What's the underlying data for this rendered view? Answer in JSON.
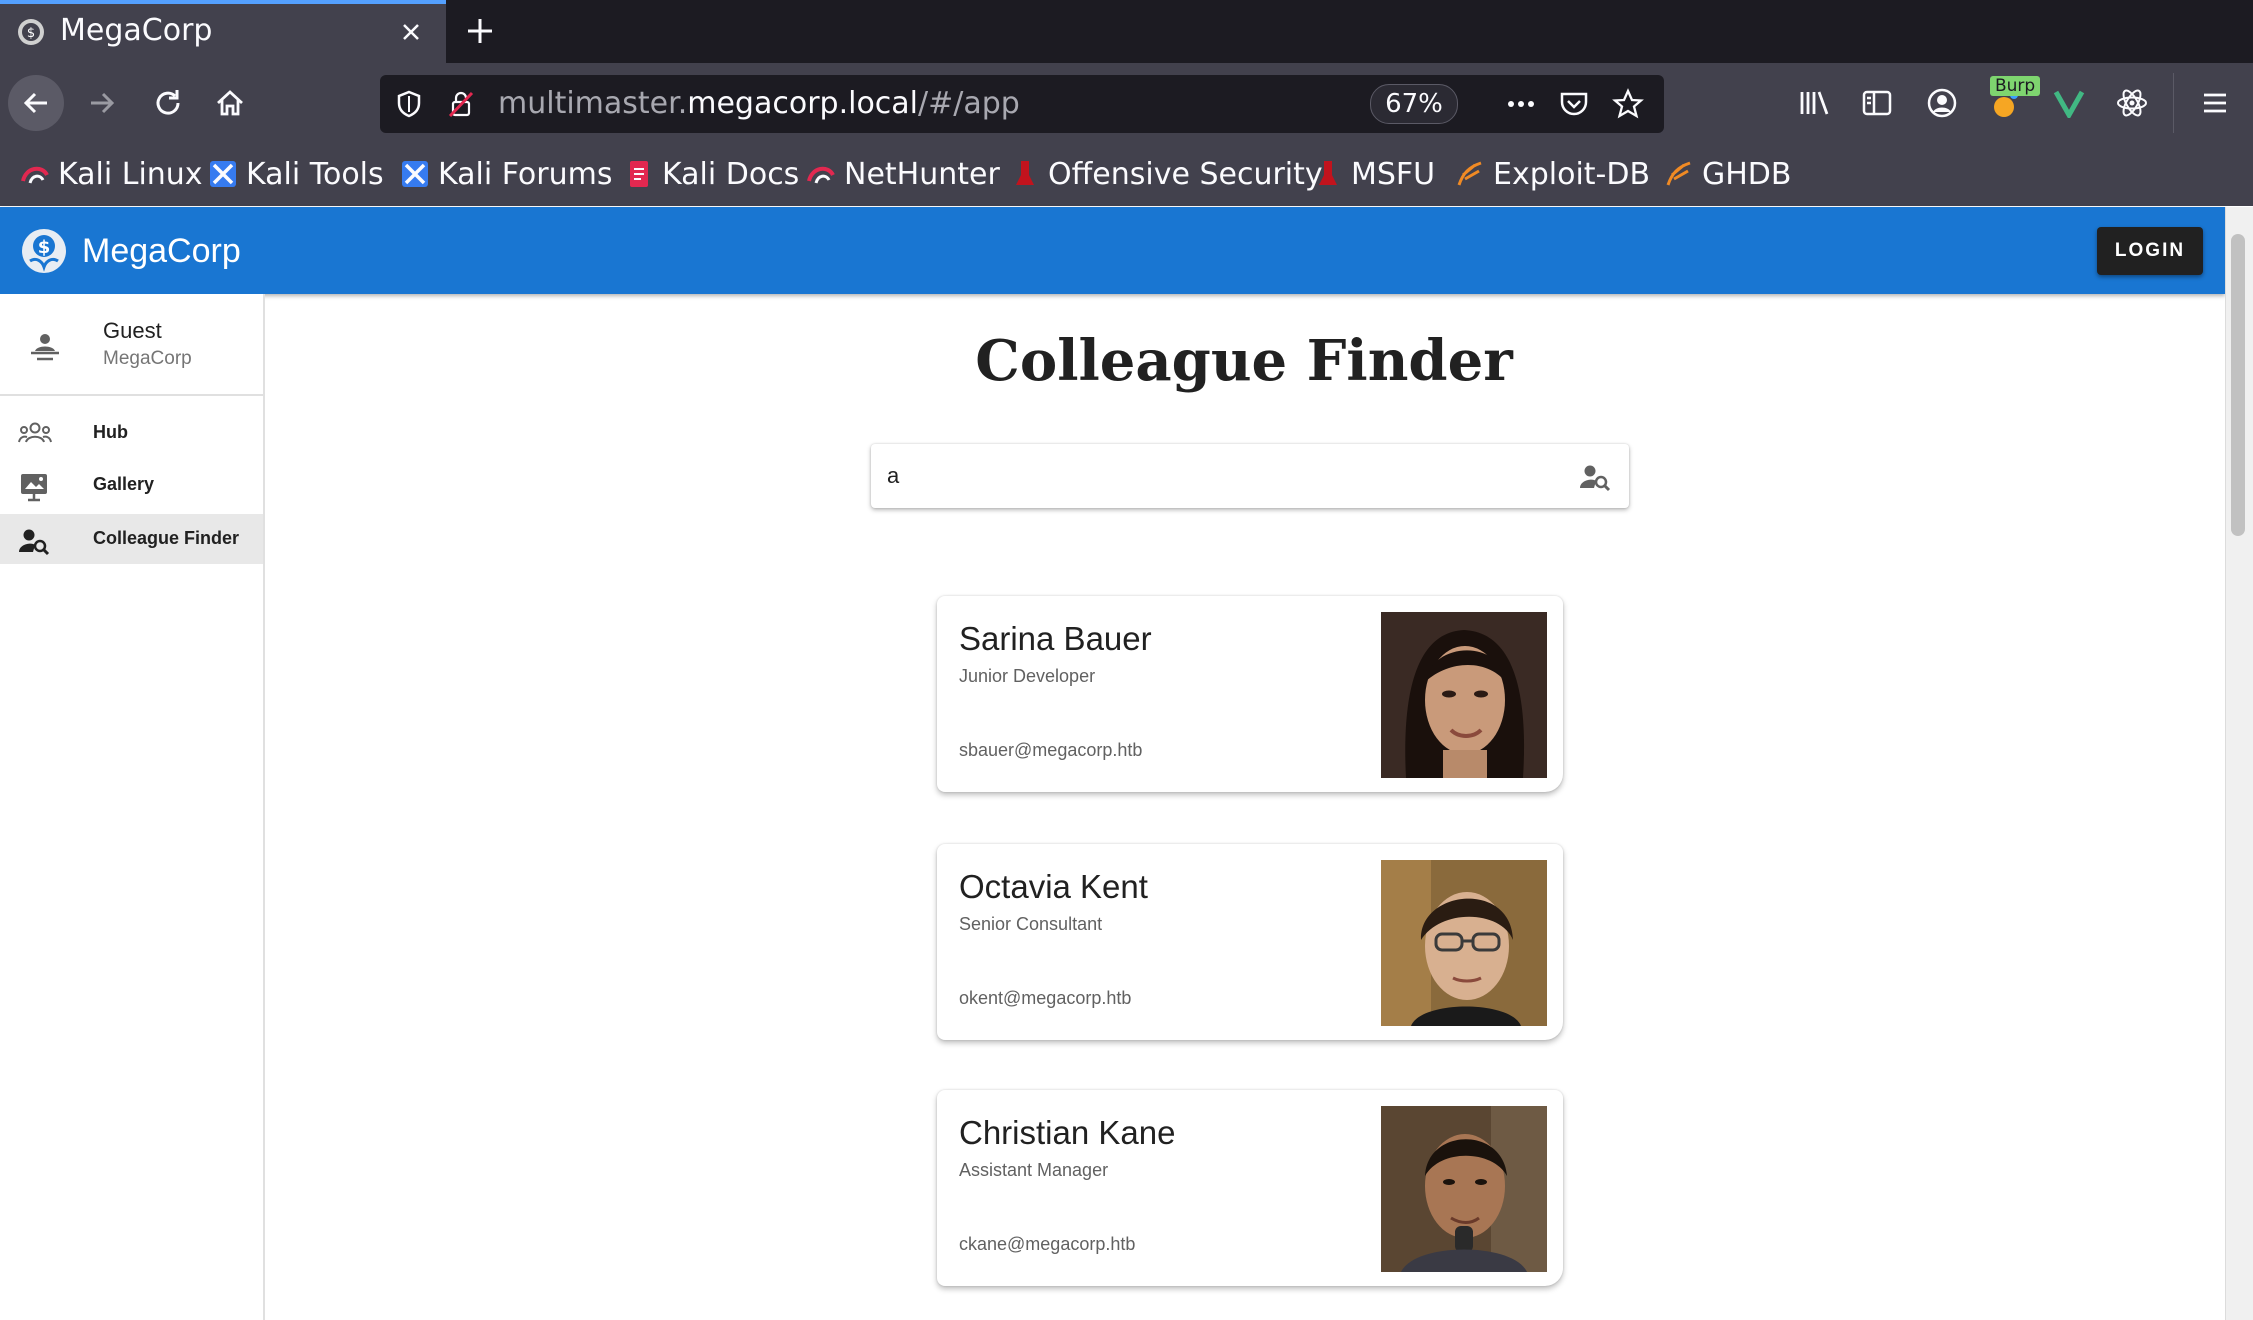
{
  "browser": {
    "tab_title": "MegaCorp",
    "url_prefix": "multimaster.",
    "url_domain": "megacorp.local",
    "url_path": "/#/app",
    "zoom": "67%",
    "burp_badge": "Burp",
    "bookmarks": [
      {
        "label": "Kali Linux",
        "icon": "kali-dragon-icon"
      },
      {
        "label": "Kali Tools",
        "icon": "kali-tools-icon"
      },
      {
        "label": "Kali Forums",
        "icon": "kali-forums-icon"
      },
      {
        "label": "Kali Docs",
        "icon": "kali-docs-icon"
      },
      {
        "label": "NetHunter",
        "icon": "nethunter-icon"
      },
      {
        "label": "Offensive Security",
        "icon": "offsec-icon"
      },
      {
        "label": "MSFU",
        "icon": "msfu-icon"
      },
      {
        "label": "Exploit-DB",
        "icon": "exploitdb-icon"
      },
      {
        "label": "GHDB",
        "icon": "ghdb-icon"
      }
    ]
  },
  "app": {
    "title": "MegaCorp",
    "login_label": "LOGIN",
    "accent_color": "#1976d2"
  },
  "drawer": {
    "user_name": "Guest",
    "user_org": "MegaCorp",
    "items": [
      {
        "label": "Hub",
        "icon": "people-icon"
      },
      {
        "label": "Gallery",
        "icon": "gallery-icon"
      },
      {
        "label": "Colleague Finder",
        "icon": "person-search-icon",
        "active": true
      }
    ]
  },
  "main": {
    "page_title": "Colleague Finder",
    "search_value": "a"
  },
  "colleagues": [
    {
      "name": "Sarina Bauer",
      "position": "Junior Developer",
      "email": "sbauer@megacorp.htb"
    },
    {
      "name": "Octavia Kent",
      "position": "Senior Consultant",
      "email": "okent@megacorp.htb"
    },
    {
      "name": "Christian Kane",
      "position": "Assistant Manager",
      "email": "ckane@megacorp.htb"
    }
  ]
}
